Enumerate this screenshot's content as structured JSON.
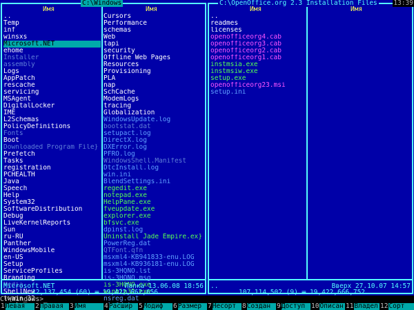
{
  "left_panel": {
    "title": "C:\\Windows",
    "col1_header": "Имя",
    "col2_header": "Имя",
    "col1": [
      {
        "name": "..",
        "color": "white"
      },
      {
        "name": "Temp",
        "color": "white"
      },
      {
        "name": "inf",
        "color": "white"
      },
      {
        "name": "winsxs",
        "color": "white"
      },
      {
        "name": "Microsoft.NET",
        "color": "white",
        "selected": true
      },
      {
        "name": "ehome",
        "color": "white"
      },
      {
        "name": "Installer",
        "color": "gray"
      },
      {
        "name": "assembly",
        "color": "gray"
      },
      {
        "name": "Logs",
        "color": "white"
      },
      {
        "name": "AppPatch",
        "color": "white"
      },
      {
        "name": "rescache",
        "color": "white"
      },
      {
        "name": "servicing",
        "color": "white"
      },
      {
        "name": "MSAgent",
        "color": "white"
      },
      {
        "name": "DigitalLocker",
        "color": "white"
      },
      {
        "name": "IME",
        "color": "white"
      },
      {
        "name": "L2Schemas",
        "color": "white"
      },
      {
        "name": "PolicyDefinitions",
        "color": "white"
      },
      {
        "name": "Fonts",
        "color": "gray"
      },
      {
        "name": "Boot",
        "color": "white"
      },
      {
        "name": "Downloaded Program File}",
        "color": "gray"
      },
      {
        "name": "Prefetch",
        "color": "white"
      },
      {
        "name": "Tasks",
        "color": "white"
      },
      {
        "name": "registration",
        "color": "white"
      },
      {
        "name": "PCHEALTH",
        "color": "white"
      },
      {
        "name": "Java",
        "color": "white"
      },
      {
        "name": "Speech",
        "color": "white"
      },
      {
        "name": "Help",
        "color": "white"
      },
      {
        "name": "System32",
        "color": "white"
      },
      {
        "name": "SoftwareDistribution",
        "color": "white"
      },
      {
        "name": "Debug",
        "color": "white"
      },
      {
        "name": "LiveKernelReports",
        "color": "white"
      },
      {
        "name": "Sun",
        "color": "white"
      },
      {
        "name": "ru-RU",
        "color": "white"
      },
      {
        "name": "Panther",
        "color": "white"
      },
      {
        "name": "WindowsMobile",
        "color": "white"
      },
      {
        "name": "en-US",
        "color": "white"
      },
      {
        "name": "Setup",
        "color": "white"
      },
      {
        "name": "ServiceProfiles",
        "color": "white"
      },
      {
        "name": "Branding",
        "color": "white"
      },
      {
        "name": "Media",
        "color": "gray"
      },
      {
        "name": "ShellNew",
        "color": "white"
      },
      {
        "name": "twain_32",
        "color": "white"
      },
      {
        "name": "system",
        "color": "white"
      }
    ],
    "col2": [
      {
        "name": "Cursors",
        "color": "white"
      },
      {
        "name": "Performance",
        "color": "white"
      },
      {
        "name": "schemas",
        "color": "white"
      },
      {
        "name": "Web",
        "color": "white"
      },
      {
        "name": "tapi",
        "color": "white"
      },
      {
        "name": "security",
        "color": "white"
      },
      {
        "name": "Offline Web Pages",
        "color": "white"
      },
      {
        "name": "Resources",
        "color": "white"
      },
      {
        "name": "Provisioning",
        "color": "white"
      },
      {
        "name": "PLA",
        "color": "white"
      },
      {
        "name": "nap",
        "color": "white"
      },
      {
        "name": "SchCache",
        "color": "white"
      },
      {
        "name": "ModemLogs",
        "color": "white"
      },
      {
        "name": "tracing",
        "color": "white"
      },
      {
        "name": "Globalization",
        "color": "white"
      },
      {
        "name": "WindowsUpdate.log",
        "color": "blue"
      },
      {
        "name": "bootstat.dat",
        "color": "gray"
      },
      {
        "name": "setupact.log",
        "color": "blue"
      },
      {
        "name": "DirectX.log",
        "color": "blue"
      },
      {
        "name": "DXError.log",
        "color": "blue"
      },
      {
        "name": "PFRO.log",
        "color": "blue"
      },
      {
        "name": "WindowsShell.Manifest",
        "color": "gray"
      },
      {
        "name": "DtcInstall.log",
        "color": "blue"
      },
      {
        "name": "win.ini",
        "color": "blue"
      },
      {
        "name": "BlendSettings.ini",
        "color": "blue"
      },
      {
        "name": "regedit.exe",
        "color": "green"
      },
      {
        "name": "notepad.exe",
        "color": "green"
      },
      {
        "name": "HelpPane.exe",
        "color": "green"
      },
      {
        "name": "fveupdate.exe",
        "color": "green"
      },
      {
        "name": "explorer.exe",
        "color": "green"
      },
      {
        "name": "bfsvc.exe",
        "color": "green"
      },
      {
        "name": "dpinst.log",
        "color": "blue"
      },
      {
        "name": "Uninstall Jade Empire.ex}",
        "color": "green"
      },
      {
        "name": "PowerReg.dat",
        "color": "blue"
      },
      {
        "name": "QTFont.qfn",
        "color": "gray"
      },
      {
        "name": "msxml4-KB941833-enu.LOG",
        "color": "blue"
      },
      {
        "name": "msxml4-KB936181-enu.LOG",
        "color": "blue"
      },
      {
        "name": "is-3HQNO.lst",
        "color": "blue"
      },
      {
        "name": "is-3HQNO.msg",
        "color": "blue"
      },
      {
        "name": "is-3HQNO.exe",
        "color": "green"
      },
      {
        "name": "winhlp32.exe",
        "color": "green"
      },
      {
        "name": "nsreg.dat",
        "color": "blue"
      },
      {
        "name": "alcfdrtm.ver",
        "color": "blue"
      }
    ],
    "status_name": "Microsoft.NET",
    "status_info": "Папка 13.06.08 18:56",
    "totals": "12,137,454 (60) ═ 19,422,662,656"
  },
  "right_panel": {
    "title": "C:\\OpenOffice.org 2.3 Installation Files",
    "col1_header": "Имя",
    "col2_header": "Имя",
    "clock": "13:39",
    "col1": [
      {
        "name": "..",
        "color": "white"
      },
      {
        "name": "readmes",
        "color": "white"
      },
      {
        "name": "licenses",
        "color": "white"
      },
      {
        "name": "openofficeorg4.cab",
        "color": "magenta"
      },
      {
        "name": "openofficeorg3.cab",
        "color": "magenta"
      },
      {
        "name": "openofficeorg2.cab",
        "color": "magenta"
      },
      {
        "name": "openofficeorg1.cab",
        "color": "magenta"
      },
      {
        "name": "instmsia.exe",
        "color": "green"
      },
      {
        "name": "instmsiw.exe",
        "color": "green"
      },
      {
        "name": "setup.exe",
        "color": "green"
      },
      {
        "name": "openofficeorg23.msi",
        "color": "magenta"
      },
      {
        "name": "setup.ini",
        "color": "blue"
      }
    ],
    "status_name": "..",
    "status_info": "Вверх 27.10.07 14:57",
    "totals": "107,114,502 (9) ═ 19,422,666,752"
  },
  "command_line": "C:\\Windows>_",
  "keybar": [
    {
      "num": "1",
      "label": "Левая"
    },
    {
      "num": "2",
      "label": "Правая"
    },
    {
      "num": "3",
      "label": "Имя"
    },
    {
      "num": "4",
      "label": "Расшир"
    },
    {
      "num": "5",
      "label": "Модиф"
    },
    {
      "num": "6",
      "label": "Размер"
    },
    {
      "num": "7",
      "label": "Несорт"
    },
    {
      "num": "8",
      "label": "Создан"
    },
    {
      "num": "9",
      "label": "Доступ"
    },
    {
      "num": "10",
      "label": "Описан"
    },
    {
      "num": "11",
      "label": "Владел"
    },
    {
      "num": "12",
      "label": "Сорт"
    }
  ],
  "colors": {
    "panel_bg": "#0000a8",
    "frame": "#55ffff",
    "selection": "#00aaaa",
    "header_text": "#ffff55"
  }
}
